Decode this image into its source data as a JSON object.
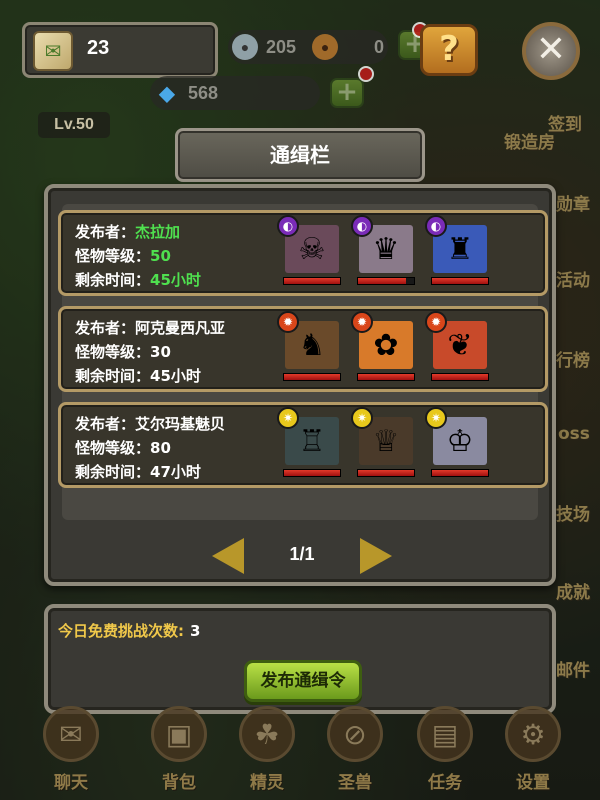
{
  "hud": {
    "scroll_count": "23",
    "silver": "205",
    "copper": "0",
    "gems": "568",
    "level": "Lv.50",
    "help_icon": "?",
    "close_icon": "✕"
  },
  "side_menu": [
    "签到",
    "锻造房",
    "勋章",
    "活动",
    "行榜",
    "oss",
    "技场",
    "成就",
    "邮件"
  ],
  "title": "通缉栏",
  "labels": {
    "publisher": "发布者：",
    "monster_level": "怪物等级：",
    "time_left": "剩余时间："
  },
  "bounties": [
    {
      "publisher": "杰拉加",
      "level": "50",
      "time": "45小时",
      "element": "dark",
      "monsters": [
        {
          "icon": "zombie-icon",
          "hp": 1.0
        },
        {
          "icon": "witch-icon",
          "hp": 0.85
        },
        {
          "icon": "robot-icon",
          "hp": 1.0
        }
      ]
    },
    {
      "publisher": "阿克曼西凡亚",
      "level": "30",
      "time": "45小时",
      "element": "fire",
      "monsters": [
        {
          "icon": "minotaur-icon",
          "hp": 1.0
        },
        {
          "icon": "fox-icon",
          "hp": 1.0
        },
        {
          "icon": "bird-icon",
          "hp": 1.0
        }
      ]
    },
    {
      "publisher": "艾尔玛基魅贝",
      "level": "80",
      "time": "47小时",
      "element": "light",
      "monsters": [
        {
          "icon": "knight-icon",
          "hp": 1.0
        },
        {
          "icon": "warrior-girl-icon",
          "hp": 1.0
        },
        {
          "icon": "blonde-girl-icon",
          "hp": 1.0
        }
      ]
    }
  ],
  "pager": "1/1",
  "free_challenges_label": "今日免费挑战次数:",
  "free_challenges_count": "3",
  "publish_button": "发布通缉令",
  "bottom_nav": [
    "聊天",
    "背包",
    "精灵",
    "圣兽",
    "任务",
    "设置"
  ],
  "colors": {
    "dark": "#7a2bb8",
    "fire": "#d9461a",
    "light": "#e8c81c",
    "highlight_green": "#4fe04f",
    "card_border": "#b49a66"
  }
}
